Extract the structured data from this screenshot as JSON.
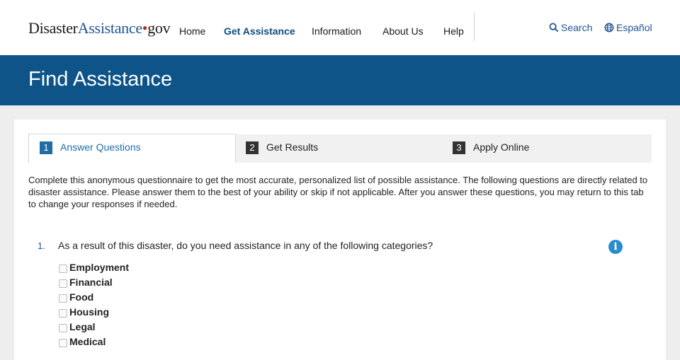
{
  "header": {
    "logo": {
      "part1": "Disaster",
      "part2": "Assistance",
      "dot": "•",
      "part3": "gov"
    },
    "nav": [
      {
        "label": "Home"
      },
      {
        "label": "Get Assistance",
        "active": true
      },
      {
        "label": "Information"
      },
      {
        "label": "About Us"
      },
      {
        "label": "Help"
      }
    ],
    "search_label": "Search",
    "language_label": "Español"
  },
  "banner": {
    "title": "Find Assistance"
  },
  "tabs": [
    {
      "num": "1",
      "label": "Answer Questions",
      "active": true
    },
    {
      "num": "2",
      "label": "Get Results"
    },
    {
      "num": "3",
      "label": "Apply Online"
    }
  ],
  "intro": "Complete this anonymous questionnaire to get the most accurate, personalized list of possible assistance. The following questions are directly related to disaster assistance. Please answer them to the best of your ability or skip if not applicable. After you answer these questions, you may return to this tab to change your responses if needed.",
  "question": {
    "number": "1.",
    "text": "As a result of this disaster, do you need assistance in any of the following categories?",
    "options": [
      {
        "label": "Employment",
        "checked": false
      },
      {
        "label": "Financial",
        "checked": false
      },
      {
        "label": "Food",
        "checked": false
      },
      {
        "label": "Housing",
        "checked": false
      },
      {
        "label": "Legal",
        "checked": false
      },
      {
        "label": "Medical",
        "checked": false
      }
    ]
  },
  "colors": {
    "brand_blue": "#0e5488",
    "accent_blue": "#1f6fa6",
    "logo_dot": "#b3282d",
    "info_blue": "#2b8ccc"
  },
  "icons": {
    "search": "search-icon",
    "language": "globe-icon",
    "info": "info-icon"
  }
}
